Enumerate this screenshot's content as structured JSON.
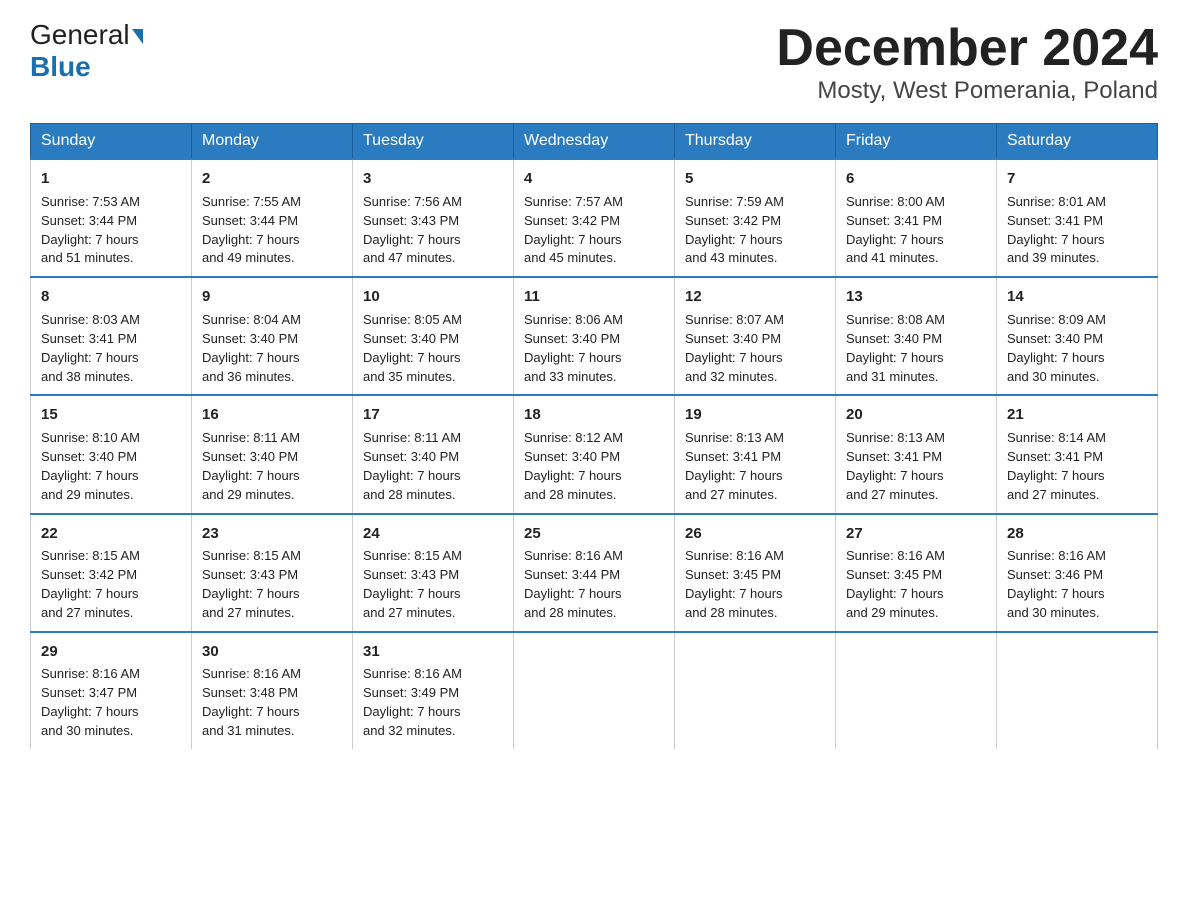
{
  "logo": {
    "line1_regular": "General",
    "line1_triangle": true,
    "line2": "Blue"
  },
  "title": "December 2024",
  "subtitle": "Mosty, West Pomerania, Poland",
  "days_of_week": [
    "Sunday",
    "Monday",
    "Tuesday",
    "Wednesday",
    "Thursday",
    "Friday",
    "Saturday"
  ],
  "weeks": [
    [
      {
        "day": "1",
        "sunrise": "7:53 AM",
        "sunset": "3:44 PM",
        "daylight": "7 hours and 51 minutes."
      },
      {
        "day": "2",
        "sunrise": "7:55 AM",
        "sunset": "3:44 PM",
        "daylight": "7 hours and 49 minutes."
      },
      {
        "day": "3",
        "sunrise": "7:56 AM",
        "sunset": "3:43 PM",
        "daylight": "7 hours and 47 minutes."
      },
      {
        "day": "4",
        "sunrise": "7:57 AM",
        "sunset": "3:42 PM",
        "daylight": "7 hours and 45 minutes."
      },
      {
        "day": "5",
        "sunrise": "7:59 AM",
        "sunset": "3:42 PM",
        "daylight": "7 hours and 43 minutes."
      },
      {
        "day": "6",
        "sunrise": "8:00 AM",
        "sunset": "3:41 PM",
        "daylight": "7 hours and 41 minutes."
      },
      {
        "day": "7",
        "sunrise": "8:01 AM",
        "sunset": "3:41 PM",
        "daylight": "7 hours and 39 minutes."
      }
    ],
    [
      {
        "day": "8",
        "sunrise": "8:03 AM",
        "sunset": "3:41 PM",
        "daylight": "7 hours and 38 minutes."
      },
      {
        "day": "9",
        "sunrise": "8:04 AM",
        "sunset": "3:40 PM",
        "daylight": "7 hours and 36 minutes."
      },
      {
        "day": "10",
        "sunrise": "8:05 AM",
        "sunset": "3:40 PM",
        "daylight": "7 hours and 35 minutes."
      },
      {
        "day": "11",
        "sunrise": "8:06 AM",
        "sunset": "3:40 PM",
        "daylight": "7 hours and 33 minutes."
      },
      {
        "day": "12",
        "sunrise": "8:07 AM",
        "sunset": "3:40 PM",
        "daylight": "7 hours and 32 minutes."
      },
      {
        "day": "13",
        "sunrise": "8:08 AM",
        "sunset": "3:40 PM",
        "daylight": "7 hours and 31 minutes."
      },
      {
        "day": "14",
        "sunrise": "8:09 AM",
        "sunset": "3:40 PM",
        "daylight": "7 hours and 30 minutes."
      }
    ],
    [
      {
        "day": "15",
        "sunrise": "8:10 AM",
        "sunset": "3:40 PM",
        "daylight": "7 hours and 29 minutes."
      },
      {
        "day": "16",
        "sunrise": "8:11 AM",
        "sunset": "3:40 PM",
        "daylight": "7 hours and 29 minutes."
      },
      {
        "day": "17",
        "sunrise": "8:11 AM",
        "sunset": "3:40 PM",
        "daylight": "7 hours and 28 minutes."
      },
      {
        "day": "18",
        "sunrise": "8:12 AM",
        "sunset": "3:40 PM",
        "daylight": "7 hours and 28 minutes."
      },
      {
        "day": "19",
        "sunrise": "8:13 AM",
        "sunset": "3:41 PM",
        "daylight": "7 hours and 27 minutes."
      },
      {
        "day": "20",
        "sunrise": "8:13 AM",
        "sunset": "3:41 PM",
        "daylight": "7 hours and 27 minutes."
      },
      {
        "day": "21",
        "sunrise": "8:14 AM",
        "sunset": "3:41 PM",
        "daylight": "7 hours and 27 minutes."
      }
    ],
    [
      {
        "day": "22",
        "sunrise": "8:15 AM",
        "sunset": "3:42 PM",
        "daylight": "7 hours and 27 minutes."
      },
      {
        "day": "23",
        "sunrise": "8:15 AM",
        "sunset": "3:43 PM",
        "daylight": "7 hours and 27 minutes."
      },
      {
        "day": "24",
        "sunrise": "8:15 AM",
        "sunset": "3:43 PM",
        "daylight": "7 hours and 27 minutes."
      },
      {
        "day": "25",
        "sunrise": "8:16 AM",
        "sunset": "3:44 PM",
        "daylight": "7 hours and 28 minutes."
      },
      {
        "day": "26",
        "sunrise": "8:16 AM",
        "sunset": "3:45 PM",
        "daylight": "7 hours and 28 minutes."
      },
      {
        "day": "27",
        "sunrise": "8:16 AM",
        "sunset": "3:45 PM",
        "daylight": "7 hours and 29 minutes."
      },
      {
        "day": "28",
        "sunrise": "8:16 AM",
        "sunset": "3:46 PM",
        "daylight": "7 hours and 30 minutes."
      }
    ],
    [
      {
        "day": "29",
        "sunrise": "8:16 AM",
        "sunset": "3:47 PM",
        "daylight": "7 hours and 30 minutes."
      },
      {
        "day": "30",
        "sunrise": "8:16 AM",
        "sunset": "3:48 PM",
        "daylight": "7 hours and 31 minutes."
      },
      {
        "day": "31",
        "sunrise": "8:16 AM",
        "sunset": "3:49 PM",
        "daylight": "7 hours and 32 minutes."
      },
      null,
      null,
      null,
      null
    ]
  ],
  "labels": {
    "sunrise": "Sunrise:",
    "sunset": "Sunset:",
    "daylight": "Daylight:"
  }
}
